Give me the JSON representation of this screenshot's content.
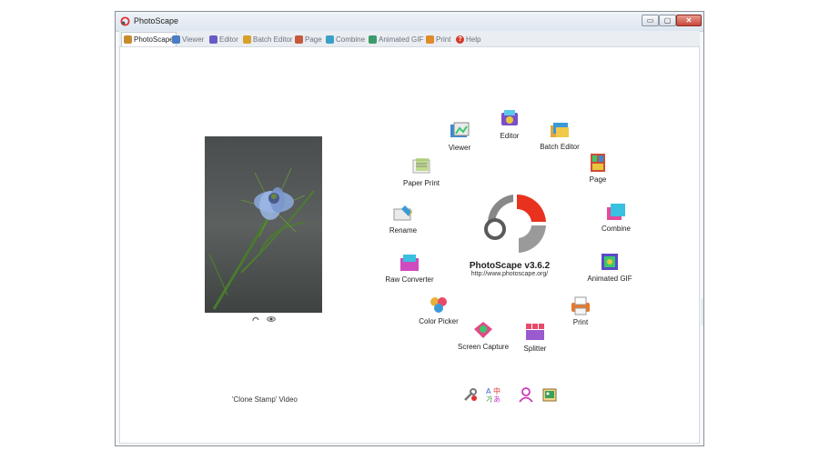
{
  "window": {
    "title": "PhotoScape",
    "min_glyph": "▭",
    "max_glyph": "▢",
    "close_glyph": "✕"
  },
  "tabs": [
    {
      "label": "PhotoScape",
      "color": "#c98a2a"
    },
    {
      "label": "Viewer",
      "color": "#4b7cc4"
    },
    {
      "label": "Editor",
      "color": "#6a5ac8"
    },
    {
      "label": "Batch Editor",
      "color": "#d7a12a"
    },
    {
      "label": "Page",
      "color": "#c45a3b"
    },
    {
      "label": "Combine",
      "color": "#3aa0c8"
    },
    {
      "label": "Animated GIF",
      "color": "#3a9a6a"
    },
    {
      "label": "Print",
      "color": "#e08a2a"
    },
    {
      "label": "Help",
      "color": "#d23b2b",
      "glyph": "?"
    }
  ],
  "main": {
    "video_label": "'Clone Stamp' Video",
    "brand": "PhotoScape v3.6.2",
    "url": "http://www.photoscape.org/"
  },
  "ring": [
    {
      "label": "Editor",
      "color": "#7a4fc8"
    },
    {
      "label": "Batch Editor",
      "color": "#e0a83a"
    },
    {
      "label": "Page",
      "color": "#d04a3a"
    },
    {
      "label": "Combine",
      "color": "#e44a9a"
    },
    {
      "label": "Animated GIF",
      "color": "#5a4ac8"
    },
    {
      "label": "Print",
      "color": "#e8782a"
    },
    {
      "label": "Splitter",
      "color": "#9a5ad0"
    },
    {
      "label": "Screen Capture",
      "color": "#e04a8a"
    },
    {
      "label": "Color Picker",
      "color": "#e8b03a"
    },
    {
      "label": "Raw Converter",
      "color": "#d04ac0"
    },
    {
      "label": "Rename",
      "color": "#3a9ad8"
    },
    {
      "label": "Paper Print",
      "color": "#9ac84a"
    },
    {
      "label": "Viewer",
      "color": "#3a8ad0"
    }
  ]
}
